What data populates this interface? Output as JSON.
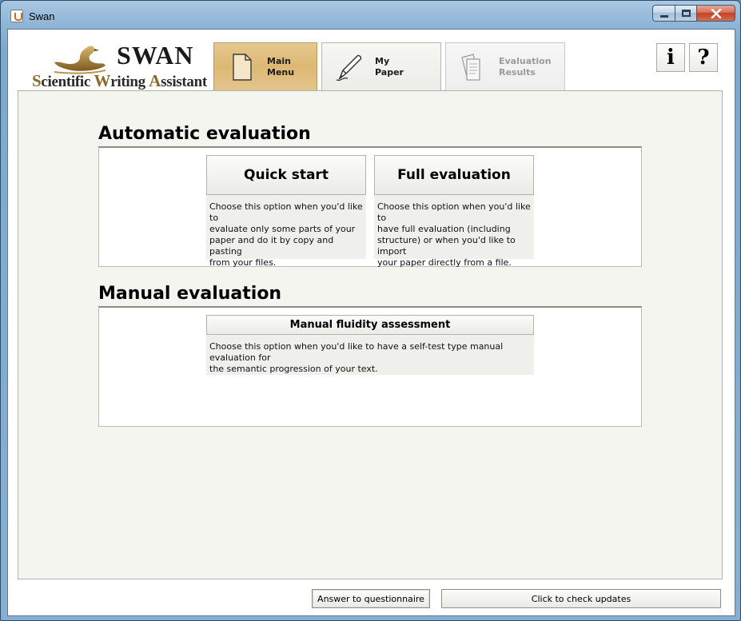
{
  "window": {
    "title": "Swan"
  },
  "logo": {
    "brand": "SWAN",
    "sub_caps": [
      "S",
      "W",
      "A"
    ],
    "sub_parts": [
      "cientific ",
      "riting ",
      "ssistant"
    ]
  },
  "tabs": [
    {
      "line1": "Main",
      "line2": "Menu",
      "icon": "document-icon",
      "active": true
    },
    {
      "line1": "My",
      "line2": "Paper",
      "icon": "pen-icon",
      "active": false
    },
    {
      "line1": "Evaluation",
      "line2": "Results",
      "icon": "documents-icon",
      "active": false,
      "disabled": true
    }
  ],
  "header_buttons": {
    "info": "i",
    "help": "?"
  },
  "automatic": {
    "title": "Automatic evaluation",
    "quick_start": {
      "label": "Quick start",
      "desc_lines": [
        "Choose this option when you'd like to",
        "evaluate only some parts of your",
        "paper and do it by copy and pasting",
        "from your files."
      ]
    },
    "full_evaluation": {
      "label": "Full evaluation",
      "desc_lines": [
        "Choose this option when you'd like to",
        "have full evaluation (including",
        "structure) or when you'd like to import",
        "your paper directly from a file."
      ]
    }
  },
  "manual": {
    "title": "Manual evaluation",
    "fluidity": {
      "label": "Manual fluidity assessment",
      "desc_lines": [
        "Choose this option when you'd like to have a self-test type manual evaluation for",
        "the semantic progression of your text."
      ]
    }
  },
  "footer": {
    "questionnaire_label": "Answer to questionnaire",
    "updates_label": "Click to check updates"
  },
  "colors": {
    "active_tab": "#ddb873",
    "panel_bg": "#f5f5f0",
    "card_bg": "#efefeb"
  }
}
